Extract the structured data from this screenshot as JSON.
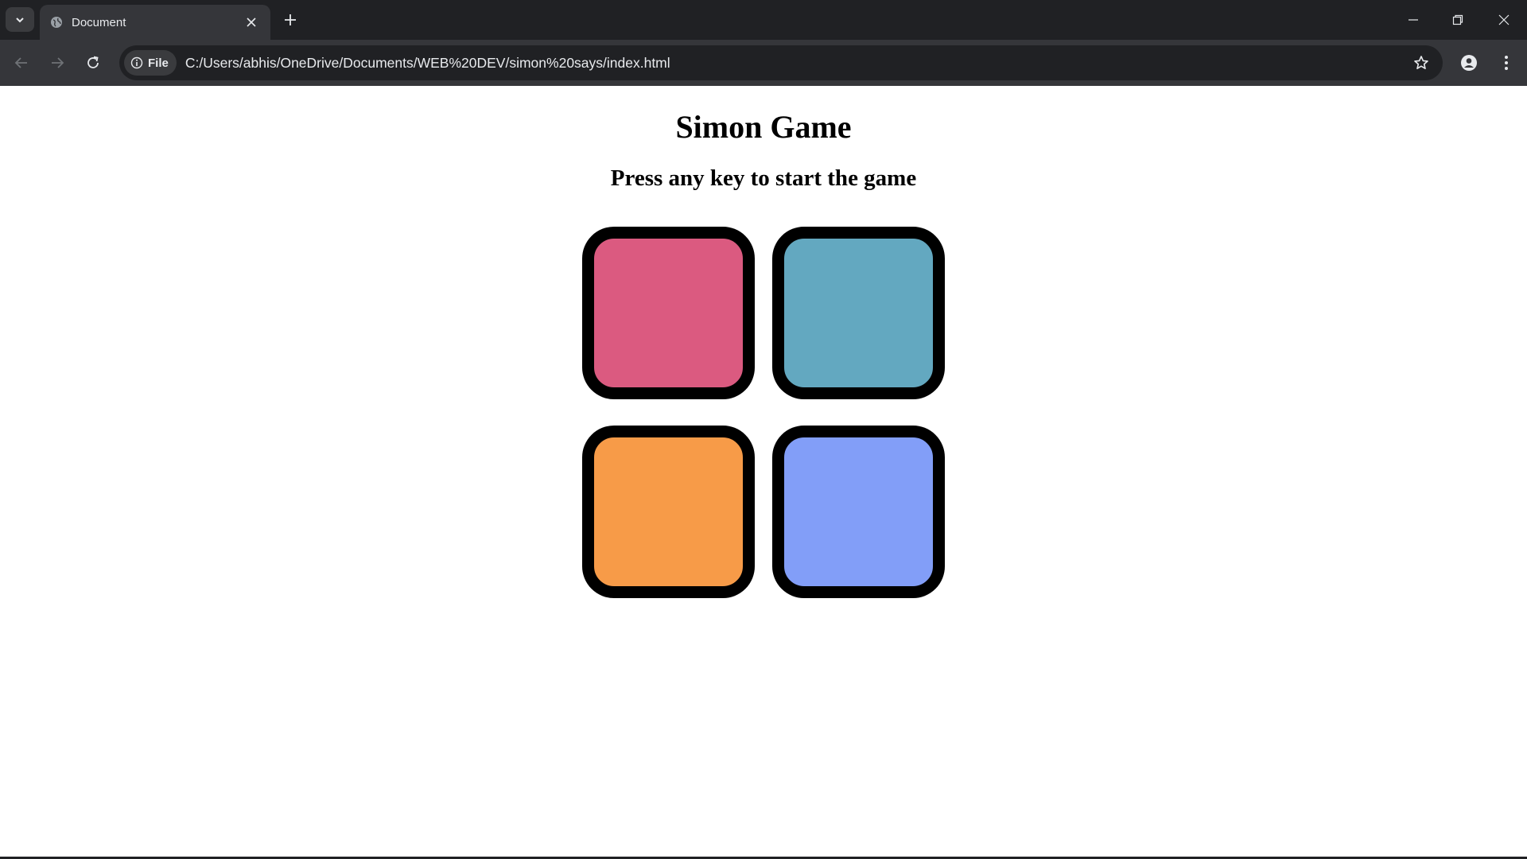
{
  "browser": {
    "tab": {
      "title": "Document"
    },
    "address_bar": {
      "site_info_label": "File",
      "url": "C:/Users/abhis/OneDrive/Documents/WEB%20DEV/simon%20says/index.html"
    },
    "icons": {
      "tab_search": "chevron-down-icon",
      "favicon": "globe-icon",
      "tab_close": "close-icon",
      "new_tab": "plus-icon",
      "minimize": "minimize-icon",
      "restore": "restore-icon",
      "close_window": "close-icon",
      "back": "arrow-left-icon",
      "forward": "arrow-right-icon",
      "reload": "reload-icon",
      "site_info": "info-icon",
      "bookmark": "star-icon",
      "profile": "person-icon",
      "menu": "more-vertical-icon"
    }
  },
  "page": {
    "level_title": "Simon Game",
    "instruction": "Press any key to start the game",
    "buttons": [
      {
        "id": "red",
        "color": "#db5a80"
      },
      {
        "id": "green",
        "color": "#63a8c0"
      },
      {
        "id": "yellow",
        "color": "#f79b48"
      },
      {
        "id": "blue",
        "color": "#829ef8"
      }
    ]
  },
  "colors": {
    "chrome_dark": "#202124",
    "chrome_toolbar": "#35363a",
    "chrome_text": "#e8eaed",
    "button_border": "#000000"
  }
}
